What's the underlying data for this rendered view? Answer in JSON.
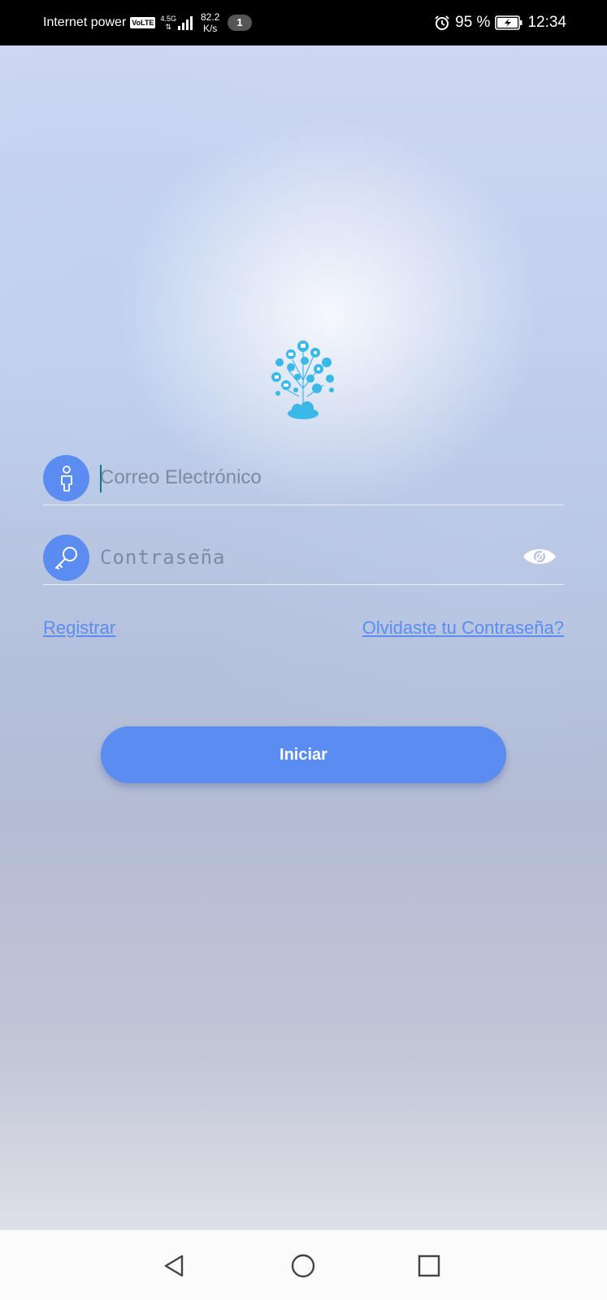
{
  "status_bar": {
    "carrier": "Internet power",
    "volte": "VoLTE",
    "network": "4.5G",
    "speed_value": "82.2",
    "speed_unit": "K/s",
    "notification_count": "1",
    "battery_percent": "95 %",
    "time": "12:34"
  },
  "login": {
    "email_placeholder": "Correo Electrónico",
    "password_placeholder": "Contraseña",
    "register_link": "Registrar",
    "forgot_link": "Olvidaste tu Contraseña?",
    "submit_label": "Iniciar"
  },
  "colors": {
    "accent": "#5b8cf0",
    "logo": "#3ab8e8"
  },
  "icons": {
    "email_field": "user-icon",
    "password_field": "key-icon",
    "password_toggle": "eye-icon",
    "nav": [
      "back-icon",
      "home-icon",
      "recent-apps-icon"
    ]
  }
}
